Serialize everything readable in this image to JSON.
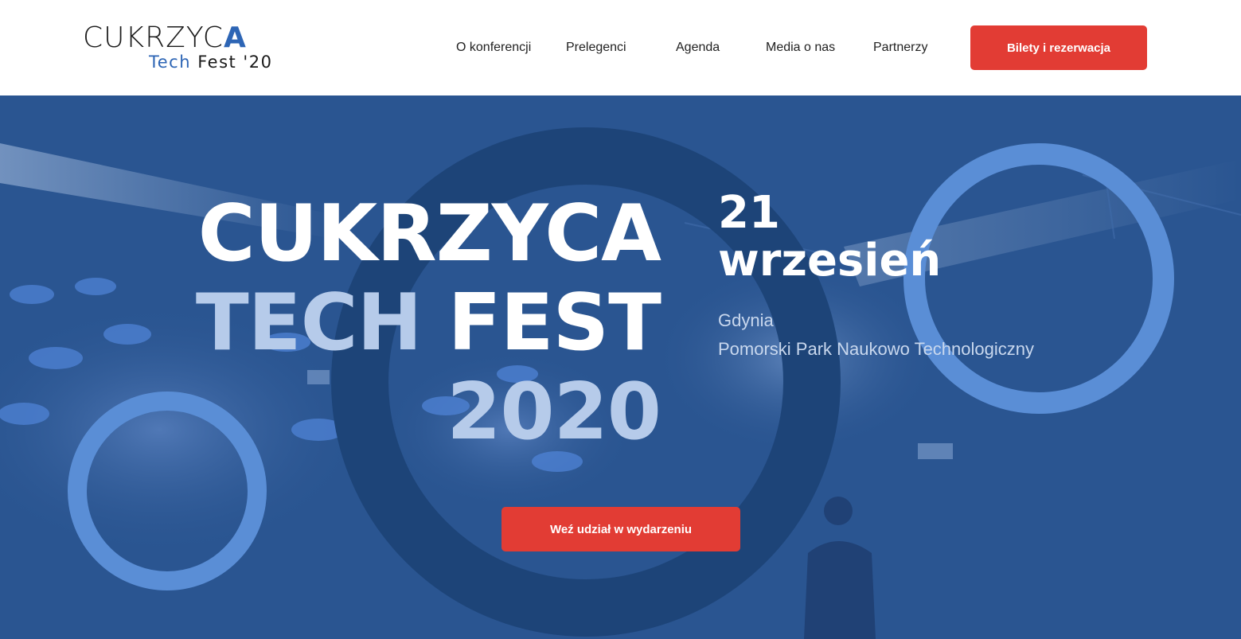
{
  "logo": {
    "top_text_main": "CUKRZYC",
    "top_text_accent": "A",
    "bottom_tech": "Tech",
    "bottom_fest": "Fest '20"
  },
  "nav": {
    "items": [
      {
        "label": "O konferencji"
      },
      {
        "label": "Prelegenci"
      },
      {
        "label": "Agenda"
      },
      {
        "label": "Media o nas"
      },
      {
        "label": "Partnerzy"
      }
    ],
    "cta_label": "Bilety i rezerwacja"
  },
  "hero": {
    "title": {
      "line1": "CUKRZYCA",
      "line2_part1": "TECH",
      "line2_part2": "FEST",
      "line3": "2020"
    },
    "date": {
      "day": "21",
      "month": "wrzesień"
    },
    "location": {
      "city": "Gdynia",
      "venue": "Pomorski Park Naukowo Technologiczny"
    },
    "cta_label": "Weź udział w wydarzeniu"
  },
  "colors": {
    "brand_blue": "#2d65b5",
    "hero_bg": "#2a5591",
    "ring_dark": "#1d4478",
    "ring_light": "#5a8ed6",
    "title_light": "#b6cbea",
    "cta_red": "#e23c34"
  }
}
